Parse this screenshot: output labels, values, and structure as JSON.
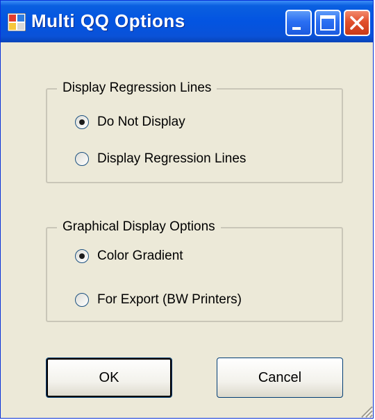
{
  "window": {
    "title": "Multi QQ Options"
  },
  "regression_group": {
    "legend": "Display Regression Lines",
    "options": [
      {
        "label": "Do Not Display",
        "checked": true
      },
      {
        "label": "Display Regression Lines",
        "checked": false
      }
    ]
  },
  "display_group": {
    "legend": "Graphical Display Options",
    "options": [
      {
        "label": "Color Gradient",
        "checked": true
      },
      {
        "label": "For Export (BW Printers)",
        "checked": false
      }
    ]
  },
  "buttons": {
    "ok": "OK",
    "cancel": "Cancel"
  },
  "colors": {
    "titlebar": "#0354e1",
    "window_bg": "#ece9d8",
    "close": "#e1502d"
  }
}
